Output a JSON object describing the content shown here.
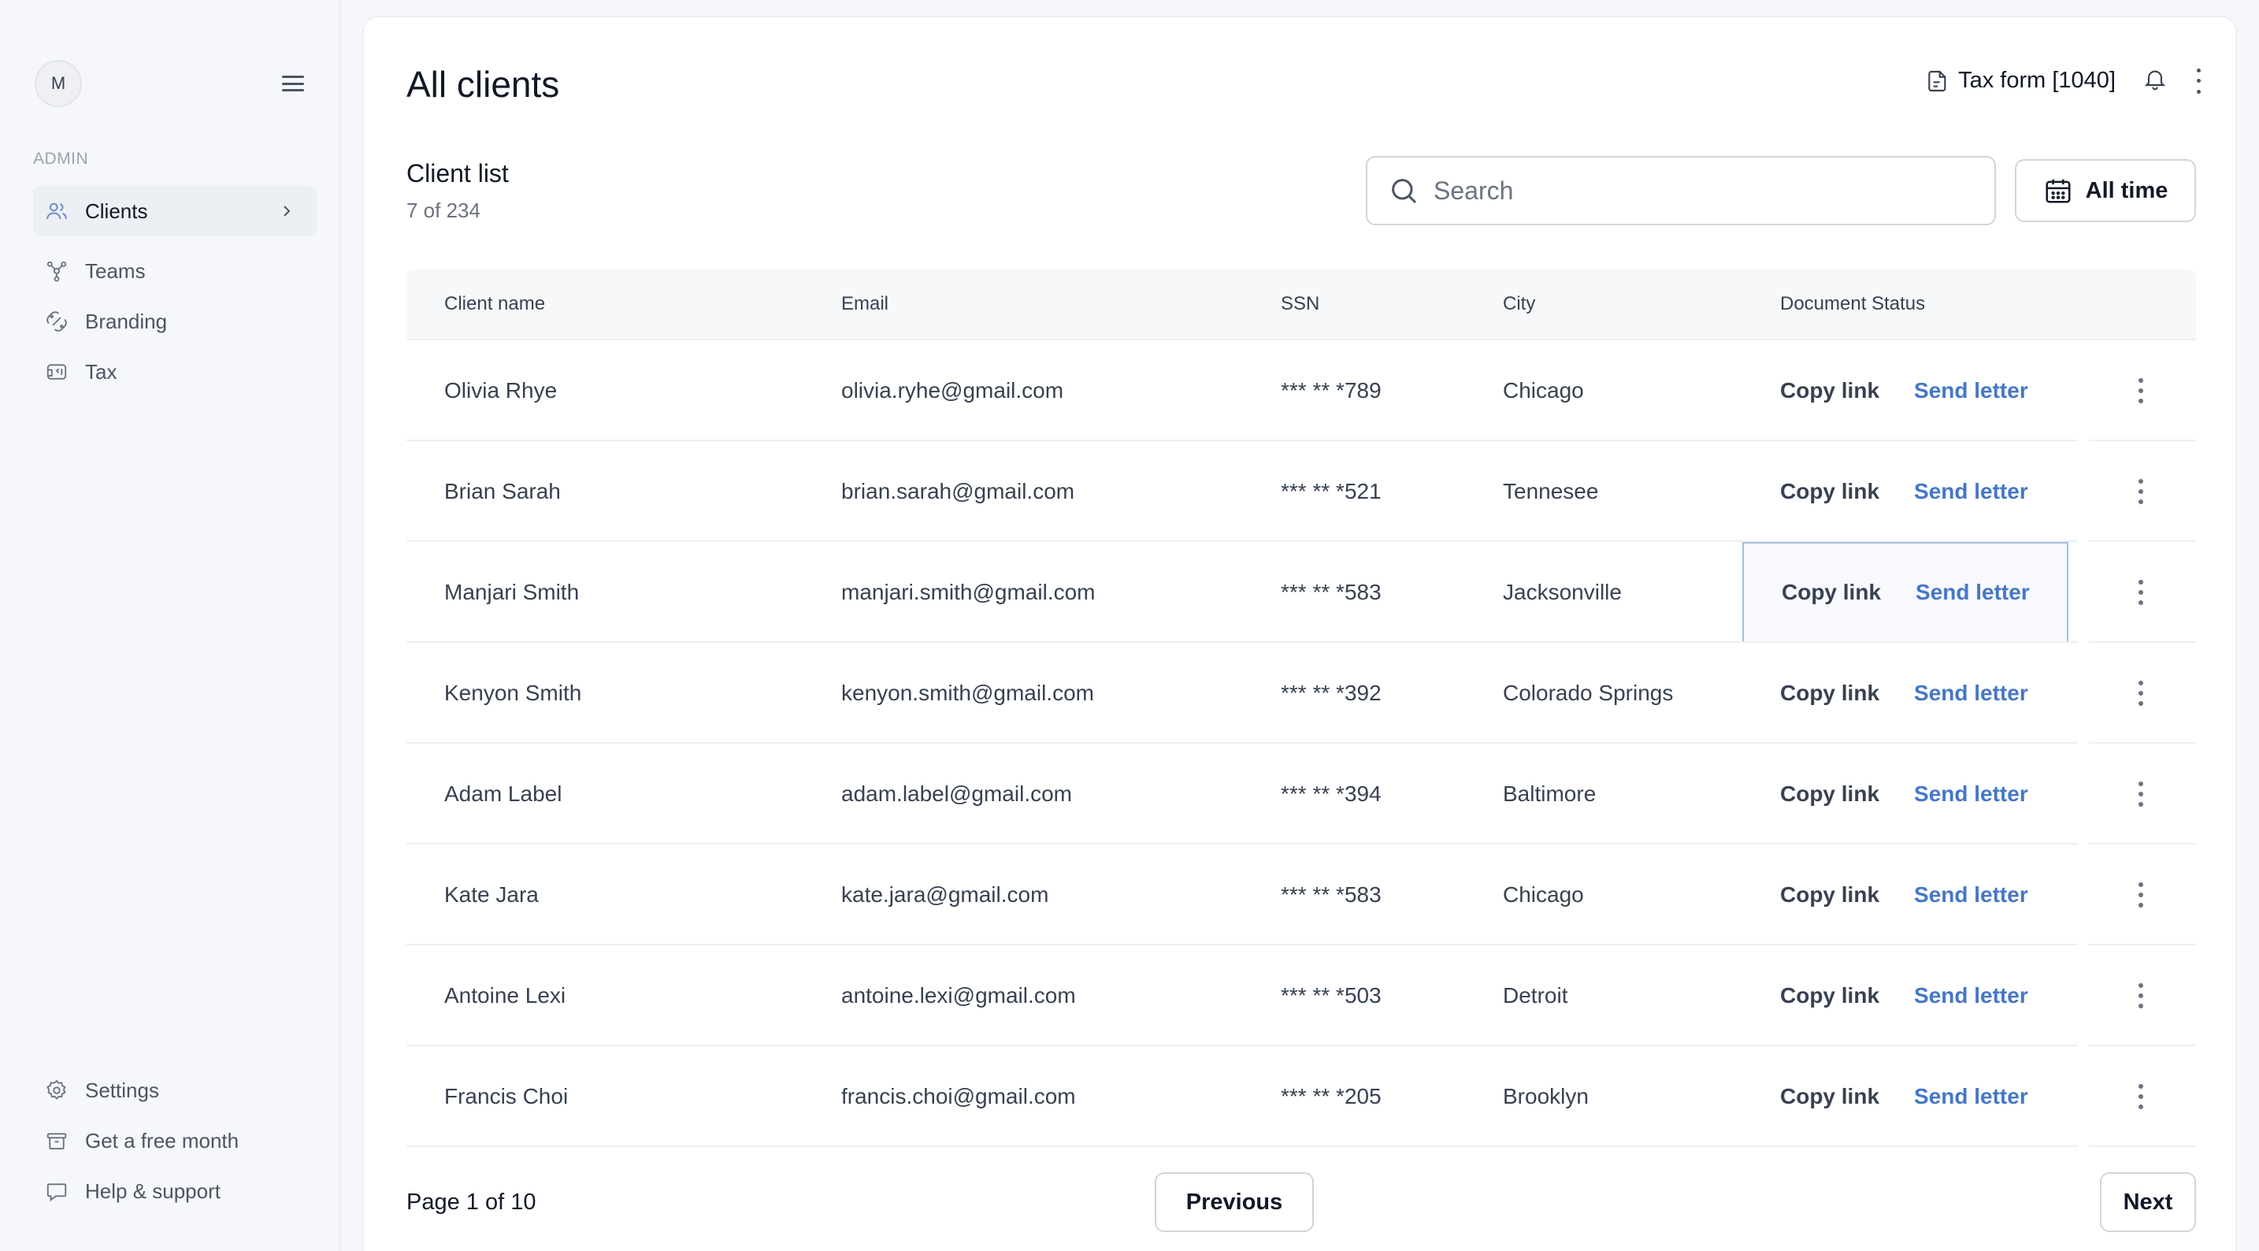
{
  "user": {
    "avatar_initial": "M"
  },
  "sidebar": {
    "section_label": "ADMIN",
    "items": [
      {
        "label": "Clients",
        "icon": "users-icon",
        "active": true
      },
      {
        "label": "Teams",
        "icon": "teams-icon"
      },
      {
        "label": "Branding",
        "icon": "branding-icon"
      },
      {
        "label": "Tax",
        "icon": "tax-icon"
      }
    ],
    "footer_items": [
      {
        "label": "Settings",
        "icon": "gear-icon"
      },
      {
        "label": "Get a free month",
        "icon": "gift-icon"
      },
      {
        "label": "Help & support",
        "icon": "chat-icon"
      }
    ]
  },
  "header": {
    "title": "All clients",
    "tax_form_label": "Tax form [1040]"
  },
  "list": {
    "title": "Client list",
    "count": "7 of 234",
    "search_placeholder": "Search",
    "date_filter": "All time"
  },
  "table": {
    "columns": [
      "Client name",
      "Email",
      "SSN",
      "City",
      "Document Status"
    ],
    "copy_label": "Copy link",
    "send_label": "Send letter",
    "rows": [
      {
        "name": "Olivia Rhye",
        "email": "olivia.ryhe@gmail.com",
        "ssn": "*** ** *789",
        "city": "Chicago"
      },
      {
        "name": "Brian Sarah",
        "email": "brian.sarah@gmail.com",
        "ssn": "*** ** *521",
        "city": "Tennesee"
      },
      {
        "name": "Manjari Smith",
        "email": "manjari.smith@gmail.com",
        "ssn": "*** ** *583",
        "city": "Jacksonville",
        "focused": true
      },
      {
        "name": "Kenyon Smith",
        "email": "kenyon.smith@gmail.com",
        "ssn": "*** ** *392",
        "city": "Colorado Springs"
      },
      {
        "name": "Adam Label",
        "email": "adam.label@gmail.com",
        "ssn": "*** ** *394",
        "city": "Baltimore"
      },
      {
        "name": "Kate Jara",
        "email": "kate.jara@gmail.com",
        "ssn": "*** ** *583",
        "city": "Chicago"
      },
      {
        "name": "Antoine Lexi",
        "email": "antoine.lexi@gmail.com",
        "ssn": "*** ** *503",
        "city": "Detroit"
      },
      {
        "name": "Francis Choi",
        "email": "francis.choi@gmail.com",
        "ssn": "*** ** *205",
        "city": "Brooklyn"
      }
    ]
  },
  "pagination": {
    "text": "Page 1 of 10",
    "previous": "Previous",
    "next": "Next"
  },
  "colors": {
    "accent": "#4577c7",
    "focus_border": "#a7bde0",
    "background": "#f5f7fa"
  }
}
